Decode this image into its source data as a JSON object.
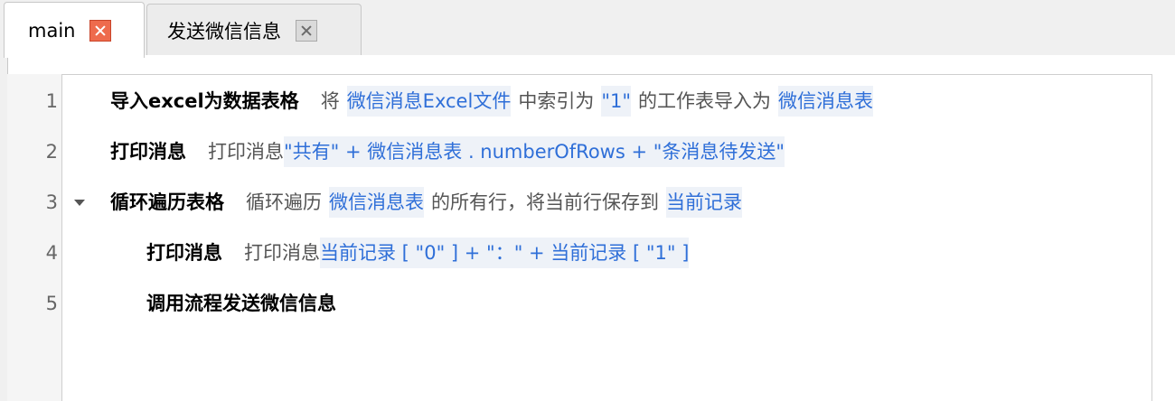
{
  "tabs": [
    {
      "label": "main",
      "active": true,
      "close_icon": "close-icon-red"
    },
    {
      "label": "发送微信信息",
      "active": false,
      "close_icon": "close-icon-grey"
    }
  ],
  "lines": [
    {
      "number": "1",
      "command": "导入excel为数据表格",
      "parts": [
        {
          "t": "txt",
          "v": "将"
        },
        {
          "t": "tok",
          "v": "微信消息Excel文件"
        },
        {
          "t": "txt",
          "v": "中索引为"
        },
        {
          "t": "tok",
          "v": "\"1\""
        },
        {
          "t": "txt",
          "v": "的工作表导入为"
        },
        {
          "t": "tok",
          "v": "微信消息表"
        }
      ]
    },
    {
      "number": "2",
      "command": "打印消息",
      "parts": [
        {
          "t": "txt",
          "v": "打印消息"
        },
        {
          "t": "tok",
          "v": "\"共有\" + 微信消息表 . numberOfRows + \"条消息待发送\""
        }
      ]
    },
    {
      "number": "3",
      "command": "循环遍历表格",
      "parts": [
        {
          "t": "txt",
          "v": "循环遍历"
        },
        {
          "t": "tok",
          "v": "微信消息表"
        },
        {
          "t": "txt",
          "v": "的所有行，将当前行保存到"
        },
        {
          "t": "tok",
          "v": "当前记录"
        }
      ]
    },
    {
      "number": "4",
      "command": "打印消息",
      "parts": [
        {
          "t": "txt",
          "v": "打印消息"
        },
        {
          "t": "tok",
          "v": "当前记录 [ \"0\" ] + \"：\" + 当前记录 [ \"1\" ]"
        }
      ]
    },
    {
      "number": "5",
      "command": "调用流程发送微信信息",
      "parts": []
    }
  ],
  "colors": {
    "token": "#2f6fd8",
    "token_bg": "#eef2f8",
    "close_red": "#ee6b4d"
  }
}
